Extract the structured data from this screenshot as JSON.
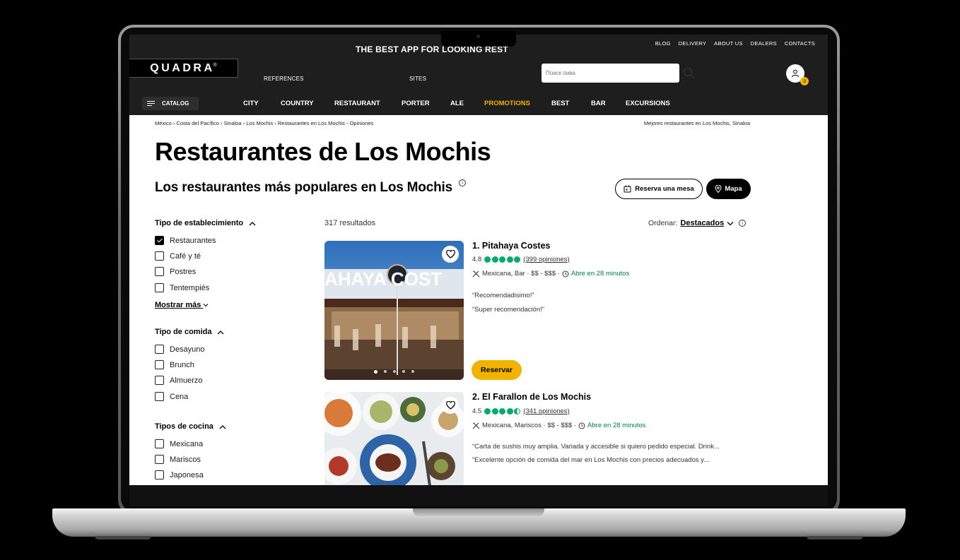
{
  "header": {
    "promo_text": "THE BEST APP FOR LOOKING REST",
    "top_links": [
      "BLOG",
      "DELIVERY",
      "ABOUT US",
      "DEALERS",
      "CONTACTS"
    ],
    "logo": "QUADRA",
    "logo_mark": "®",
    "secondary_links": [
      "REFERENCES",
      "SITES"
    ],
    "search_placeholder": "Поиск пива",
    "cart_count": "3",
    "catalog_label": "CATALOG",
    "nav": [
      {
        "label": "CITY"
      },
      {
        "label": "COUNTRY"
      },
      {
        "label": "RESTAURANT"
      },
      {
        "label": "PORTER"
      },
      {
        "label": "ALE"
      },
      {
        "label": "PROMOTIONS",
        "active": true
      },
      {
        "label": "BEST"
      },
      {
        "label": "BAR"
      },
      {
        "label": "EXCURSIONS"
      }
    ],
    "accent_color": "#f2b200"
  },
  "breadcrumb": {
    "items": [
      "México",
      "Costa del Pacífico",
      "Sinaloa",
      "Los Mochis",
      "Restaurantes en Los Mochis - Opiniones"
    ],
    "right_text": "Mejores restaurantes en Los Mochis, Sinaloa"
  },
  "page": {
    "title": "Restaurantes de Los Mochis",
    "subtitle": "Los restaurantes más populares en Los Mochis",
    "reserve_label": "Reserva una mesa",
    "map_label": "Mapa",
    "results_count": "317 resultados",
    "sort_label": "Ordenar:",
    "sort_value": "Destacados"
  },
  "filters": {
    "establishment": {
      "title": "Tipo de establecimiento",
      "items": [
        {
          "label": "Restaurantes",
          "checked": true
        },
        {
          "label": "Café y té",
          "checked": false
        },
        {
          "label": "Postres",
          "checked": false
        },
        {
          "label": "Tentempiés",
          "checked": false
        }
      ],
      "more_label": "Mostrar más"
    },
    "meal": {
      "title": "Tipo de comida",
      "items": [
        {
          "label": "Desayuno",
          "checked": false
        },
        {
          "label": "Brunch",
          "checked": false
        },
        {
          "label": "Almuerzo",
          "checked": false
        },
        {
          "label": "Cena",
          "checked": false
        }
      ]
    },
    "cuisine": {
      "title": "Tipos de cocina",
      "items": [
        {
          "label": "Mexicana",
          "checked": false
        },
        {
          "label": "Mariscos",
          "checked": false
        },
        {
          "label": "Japonesa",
          "checked": false
        }
      ]
    }
  },
  "results": [
    {
      "title": "1. Pitahaya Costes",
      "rating": "4.8",
      "bubbles": 5,
      "reviews": "(399 opiniones)",
      "meta": "Mexicana, Bar · $$ - $$$ ·",
      "open": "Abre en 28 minutos",
      "quotes": [
        "“Recomendadisimo!”",
        "“Super recomendación!”"
      ],
      "photo_sign": "AHAYA  COST",
      "book_label": "Reservar"
    },
    {
      "title": "2. El Farallon de Los Mochis",
      "rating": "4.5",
      "bubbles": 4.5,
      "reviews": "(341 opiniones)",
      "meta": "Mexicana, Mariscos · $$ - $$$ ·",
      "open": "Abre en 28 minutos",
      "quotes": [
        "“Carta de sushis muy amplia. Variada y accesible si quiero pedido especial. Drink...",
        "“Excelente opción de comida del mar en Los Mochis con precios adecuados y..."
      ]
    }
  ]
}
